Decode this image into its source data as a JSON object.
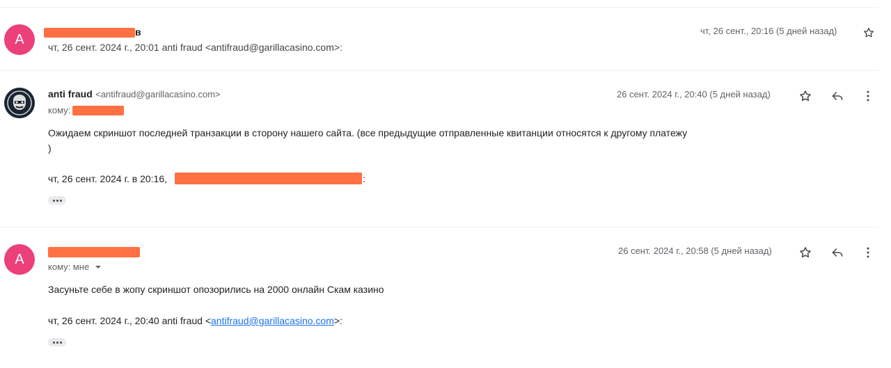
{
  "messages": [
    {
      "avatar_letter": "A",
      "date": "чт, 26 сент., 20:16 (5 дней назад)",
      "snippet": "чт, 26 сент. 2024 г., 20:01 anti fraud <antifraud@garillacasino.com>:",
      "icons": [
        "star-icon"
      ]
    },
    {
      "avatar_icon": "gorilla-logo-icon",
      "sender_name": "anti fraud",
      "sender_email": "<antifraud@garillacasino.com>",
      "to_label": "кому:",
      "date": "26 сент. 2024 г., 20:40 (5 дней назад)",
      "body_line1": "Ожидаем скриншот последней транзакции в сторону нашего сайта. (все предыдущие отправленные квитанции относятся к другому платежу",
      "body_line2": ")",
      "quote_prefix": "чт, 26 сент. 2024 г. в 20:16,",
      "quote_suffix": ":",
      "icons": [
        "star-icon",
        "reply-icon",
        "more-vert-icon"
      ]
    },
    {
      "avatar_letter": "A",
      "to_label": "кому: мне",
      "date": "26 сент. 2024 г., 20:58 (5 дней назад)",
      "body": "Засуньте себе в жопу скриншот опозорились на 2000 онлайн Скам казино",
      "quote_prefix": "чт, 26 сент. 2024 г., 20:40 anti fraud <",
      "quote_link": "antifraud@garillacasino.com",
      "quote_suffix": ">:",
      "icons": [
        "star-icon",
        "reply-icon",
        "more-vert-icon"
      ]
    }
  ],
  "colors": {
    "avatar": "#ec407a",
    "redaction": "#ff7043",
    "link": "#1a73e8"
  }
}
